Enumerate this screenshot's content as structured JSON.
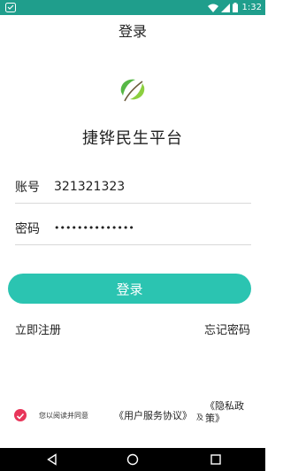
{
  "status_bar": {
    "time": "1:32",
    "icons": [
      "app-notification-icon",
      "wifi-icon",
      "signal-icon",
      "battery-icon"
    ]
  },
  "header": {
    "title": "登录"
  },
  "brand": {
    "name": "捷铧民生平台",
    "logo_icon": "leaf-logo-icon"
  },
  "form": {
    "account_label": "账号",
    "account_value": "321321323",
    "password_label": "密码",
    "password_value": "••••••••••••••"
  },
  "login_button": {
    "label": "登录"
  },
  "links": {
    "register": "立即注册",
    "forgot_password": "忘记密码"
  },
  "agreement": {
    "checked": true,
    "prefix": "您以阅读并同意",
    "user_agreement": "《用户服务协议》",
    "conjunction": "及",
    "privacy_policy": "《隐私政策》"
  },
  "colors": {
    "accent": "#2bc4b1",
    "status_bar": "#1f9e8c",
    "checkbox": "#e8355a"
  },
  "nav_bar": {
    "icons": [
      "back-icon",
      "home-icon",
      "recent-apps-icon"
    ]
  }
}
